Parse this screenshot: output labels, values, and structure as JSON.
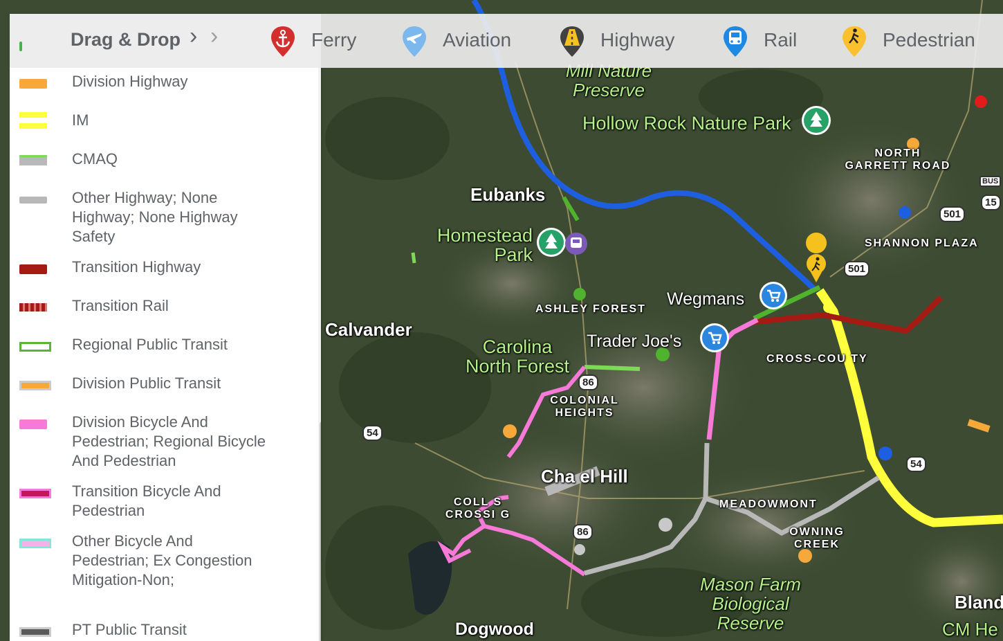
{
  "toolbar": {
    "drag_drop": "Drag & Drop",
    "categories": [
      {
        "label": "Ferry",
        "icon": "anchor-icon",
        "color": "#d32f2f"
      },
      {
        "label": "Aviation",
        "icon": "airplane-icon",
        "color": "#64b5f6"
      },
      {
        "label": "Highway",
        "icon": "road-icon",
        "color": "#424242"
      },
      {
        "label": "Rail",
        "icon": "bus-icon",
        "color": "#1e88e5"
      },
      {
        "label": "Pedestrian",
        "icon": "walking-person-icon",
        "color": "#fbc02d"
      }
    ]
  },
  "legend": {
    "items": [
      {
        "label": "Division Highway",
        "color": "#f7a83b"
      },
      {
        "label": "IM",
        "color": "#ffff3b"
      },
      {
        "label": "CMAQ",
        "color": "#7ed957"
      },
      {
        "label": "Other Highway; None Highway; None Highway Safety",
        "color": "#b8b8b8"
      },
      {
        "label": "Transition Highway",
        "color": "#a51b14"
      },
      {
        "label": "Transition Rail",
        "color": "#a51b14"
      },
      {
        "label": "Regional Public Transit",
        "color": "#7ed957"
      },
      {
        "label": "Division Public Transit",
        "color": "#f7a83b"
      },
      {
        "label": "Division Bicycle And Pedestrian; Regional Bicycle And Pedestrian",
        "color": "#f77ad8"
      },
      {
        "label": "Transition Bicycle And Pedestrian",
        "color": "#c2185b"
      },
      {
        "label": "Other Bicycle And Pedestrian; Ex Congestion Mitigation-Non;",
        "color": "#84e8d8"
      },
      {
        "label": "PT Public Transit",
        "color": "#5a5a5a"
      }
    ]
  },
  "map": {
    "places": {
      "mill_nature_preserve": "Mill Nature Preserve",
      "hollow_rock": "Hollow Rock Nature Park",
      "north_garrett": "NORTH GARRETT ROAD",
      "eubanks": "Eubanks",
      "homestead_park": "Homestead Park",
      "shannon_plaza": "SHANNON PLAZA",
      "wegmans": "Wegmans",
      "ashley_forest": "ASHLEY FOREST",
      "calvander": "Calvander",
      "trader_joes": "Trader Joe's",
      "carolina_north_forest": "Carolina North Forest",
      "cross_county": "CROSS-COU TY",
      "colonial_heights": "COLONIAL HEIGHTS",
      "chapel_hill": "Cha el Hill",
      "collins_crossing": "COLL S CROSSI G",
      "meadowmont": "MEADOWMONT",
      "downing_creek": "OWNING CREEK",
      "mason_farm": "Mason Farm Biological Reserve",
      "dogwood": "Dogwood",
      "bland": "Bland",
      "cm_her": "CM He"
    },
    "shields": {
      "s501a": "501",
      "s501b": "501",
      "s15": "15",
      "bus": "BUS",
      "s86a": "86",
      "s86b": "86",
      "s54a": "54",
      "s54b": "54"
    }
  }
}
